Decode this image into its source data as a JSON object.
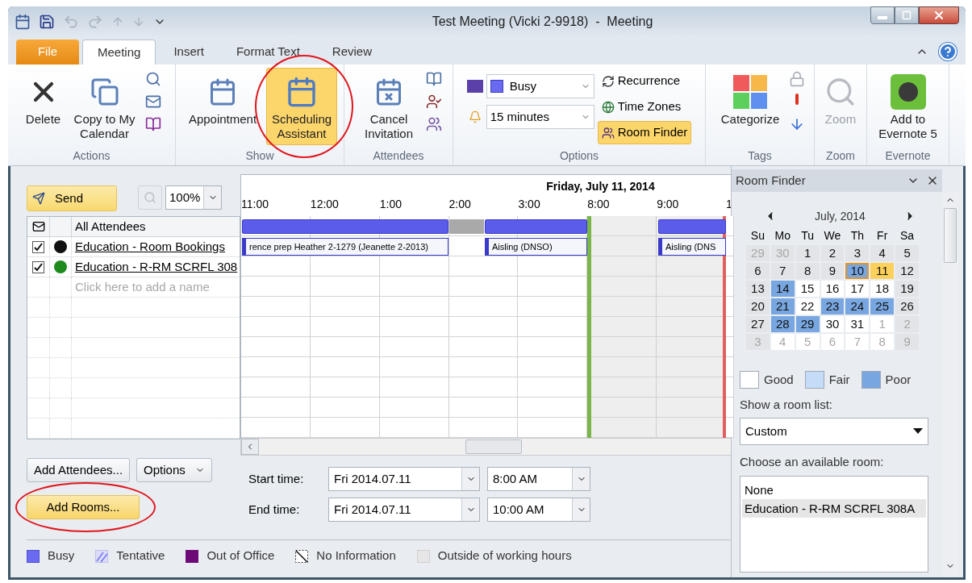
{
  "window": {
    "title": "Test Meeting (Vicki 2-9918)  -  Meeting"
  },
  "tabs": [
    {
      "label": "File",
      "kind": "file",
      "selected": false
    },
    {
      "label": "Meeting",
      "kind": "tab",
      "selected": true
    },
    {
      "label": "Insert",
      "kind": "tab",
      "selected": false
    },
    {
      "label": "Format Text",
      "kind": "tab",
      "selected": false
    },
    {
      "label": "Review",
      "kind": "tab",
      "selected": false
    }
  ],
  "ribbon": [
    {
      "kind": "actions",
      "label": "Actions",
      "buttons": [
        {
          "label": "Delete"
        },
        {
          "label": "Copy to My Calendar"
        }
      ]
    },
    {
      "kind": "show",
      "label": "Show",
      "buttons": [
        {
          "label": "Appointment",
          "selected": false,
          "circled": false
        },
        {
          "label": "Scheduling Assistant",
          "selected": true,
          "circled": true
        }
      ]
    },
    {
      "kind": "attendees",
      "label": "Attendees",
      "buttons": [
        {
          "label": "Cancel Invitation"
        }
      ]
    },
    {
      "kind": "options",
      "label": "Options",
      "show_as": "Busy",
      "reminder": "15 minutes",
      "buttons": [
        {
          "label": "Recurrence",
          "selected": false
        },
        {
          "label": "Time Zones",
          "selected": false
        },
        {
          "label": "Room Finder",
          "selected": true
        }
      ]
    },
    {
      "kind": "tags",
      "label": "Tags",
      "buttons": [
        {
          "label": "Categorize"
        }
      ]
    },
    {
      "kind": "zoom",
      "label": "Zoom",
      "buttons": [
        {
          "label": "Zoom",
          "disabled": true
        }
      ]
    },
    {
      "kind": "evernote",
      "label": "Evernote",
      "buttons": [
        {
          "label": "Add to Evernote 5"
        }
      ]
    }
  ],
  "toolbar": {
    "send": "Send",
    "zoom": "100%"
  },
  "attendees": {
    "header": "All Attendees",
    "placeholder": "Click here to add a name",
    "rows": [
      {
        "name": "Education - Room Bookings",
        "kind": "person",
        "checked": true
      },
      {
        "name": "Education - R-RM SCRFL 308",
        "kind": "room",
        "checked": true
      }
    ]
  },
  "schedule": {
    "date": "Friday, July 11, 2014",
    "hours": [
      {
        "label": "11:00",
        "selected": false
      },
      {
        "label": "12:00",
        "selected": false
      },
      {
        "label": "1:00",
        "selected": false
      },
      {
        "label": "2:00",
        "selected": false
      },
      {
        "label": "3:00",
        "selected": false
      },
      {
        "label": "8:00",
        "selected": true
      },
      {
        "label": "9:00",
        "selected": true
      },
      {
        "label": "1",
        "selected": false
      }
    ],
    "all_attendees_slots": [
      {
        "kind": "busy"
      },
      {
        "kind": "busy"
      },
      {
        "kind": "busy"
      },
      {
        "kind": "busy"
      },
      {
        "kind": "busy"
      },
      {
        "kind": "busy"
      },
      {
        "kind": "outside"
      },
      {
        "kind": "busy"
      },
      {
        "kind": "busy"
      },
      {
        "kind": "busy"
      },
      {
        "kind": "free"
      },
      {
        "kind": "free"
      },
      {
        "kind": "busy"
      },
      {
        "kind": "busy"
      }
    ],
    "rows": [
      {
        "slots": [
          {
            "kind": "event",
            "text": "rence prep Heather 2-1279 (Jeanette 2-2013)"
          },
          {
            "kind": "event"
          },
          {
            "kind": "event"
          },
          {
            "kind": "event"
          },
          {
            "kind": "event"
          },
          {
            "kind": "event"
          },
          {
            "kind": "free"
          },
          {
            "kind": "event",
            "text": "Aisling (DNSO)"
          },
          {
            "kind": "event"
          },
          {
            "kind": "event"
          },
          {
            "kind": "free"
          },
          {
            "kind": "free"
          },
          {
            "kind": "event",
            "text": "Aisling (DNS"
          },
          {
            "kind": "event"
          }
        ]
      },
      {
        "slots": [
          {
            "kind": "free"
          },
          {
            "kind": "free"
          },
          {
            "kind": "free"
          },
          {
            "kind": "free"
          },
          {
            "kind": "free"
          },
          {
            "kind": "free"
          },
          {
            "kind": "free"
          },
          {
            "kind": "free"
          },
          {
            "kind": "free"
          },
          {
            "kind": "free"
          },
          {
            "kind": "free"
          },
          {
            "kind": "free"
          },
          {
            "kind": "free"
          },
          {
            "kind": "free"
          }
        ]
      }
    ]
  },
  "buttons": [
    {
      "label": "Add Attendees...",
      "kind": "plain",
      "circled": false
    },
    {
      "label": "Options",
      "kind": "dropdown",
      "circled": false
    },
    {
      "label": "Add Rooms...",
      "kind": "highlight",
      "circled": true
    }
  ],
  "times": [
    {
      "label": "Start time:",
      "date": "Fri 2014.07.11",
      "time": "8:00 AM"
    },
    {
      "label": "End time:",
      "date": "Fri 2014.07.11",
      "time": "10:00 AM"
    }
  ],
  "legend": [
    {
      "label": "Busy",
      "kind": "busy"
    },
    {
      "label": "Tentative",
      "kind": "tentative"
    },
    {
      "label": "Out of Office",
      "kind": "oof"
    },
    {
      "label": "No Information",
      "kind": "noinfo"
    },
    {
      "label": "Outside of working hours",
      "kind": "outside"
    }
  ],
  "room_finder": {
    "title": "Room Finder",
    "month": "July, 2014",
    "weekdays": [
      "Su",
      "Mo",
      "Tu",
      "We",
      "Th",
      "Fr",
      "Sa"
    ],
    "days": [
      {
        "label": "29",
        "kind": "none",
        "muted": true,
        "today": false,
        "selected": false
      },
      {
        "label": "30",
        "kind": "none",
        "muted": true,
        "today": false,
        "selected": false
      },
      {
        "label": "1",
        "kind": "none",
        "muted": false,
        "today": false,
        "selected": false
      },
      {
        "label": "2",
        "kind": "none",
        "muted": false,
        "today": false,
        "selected": false
      },
      {
        "label": "3",
        "kind": "none",
        "muted": false,
        "today": false,
        "selected": false
      },
      {
        "label": "4",
        "kind": "none",
        "muted": false,
        "today": false,
        "selected": false
      },
      {
        "label": "5",
        "kind": "none",
        "muted": false,
        "today": false,
        "selected": false
      },
      {
        "label": "6",
        "kind": "none",
        "muted": false,
        "today": false,
        "selected": false
      },
      {
        "label": "7",
        "kind": "none",
        "muted": false,
        "today": false,
        "selected": false
      },
      {
        "label": "8",
        "kind": "none",
        "muted": false,
        "today": false,
        "selected": false
      },
      {
        "label": "9",
        "kind": "none",
        "muted": false,
        "today": false,
        "selected": false
      },
      {
        "label": "10",
        "kind": "poor",
        "muted": false,
        "today": true,
        "selected": false
      },
      {
        "label": "11",
        "kind": "none",
        "muted": false,
        "today": false,
        "selected": true
      },
      {
        "label": "12",
        "kind": "none",
        "muted": false,
        "today": false,
        "selected": false
      },
      {
        "label": "13",
        "kind": "none",
        "muted": false,
        "today": false,
        "selected": false
      },
      {
        "label": "14",
        "kind": "poor",
        "muted": false,
        "today": false,
        "selected": false
      },
      {
        "label": "15",
        "kind": "good",
        "muted": false,
        "today": false,
        "selected": false
      },
      {
        "label": "16",
        "kind": "good",
        "muted": false,
        "today": false,
        "selected": false
      },
      {
        "label": "17",
        "kind": "good",
        "muted": false,
        "today": false,
        "selected": false
      },
      {
        "label": "18",
        "kind": "good",
        "muted": false,
        "today": false,
        "selected": false
      },
      {
        "label": "19",
        "kind": "none",
        "muted": false,
        "today": false,
        "selected": false
      },
      {
        "label": "20",
        "kind": "none",
        "muted": false,
        "today": false,
        "selected": false
      },
      {
        "label": "21",
        "kind": "poor",
        "muted": false,
        "today": false,
        "selected": false
      },
      {
        "label": "22",
        "kind": "good",
        "muted": false,
        "today": false,
        "selected": false
      },
      {
        "label": "23",
        "kind": "poor",
        "muted": false,
        "today": false,
        "selected": false
      },
      {
        "label": "24",
        "kind": "poor",
        "muted": false,
        "today": false,
        "selected": false
      },
      {
        "label": "25",
        "kind": "poor",
        "muted": false,
        "today": false,
        "selected": false
      },
      {
        "label": "26",
        "kind": "none",
        "muted": false,
        "today": false,
        "selected": false
      },
      {
        "label": "27",
        "kind": "none",
        "muted": false,
        "today": false,
        "selected": false
      },
      {
        "label": "28",
        "kind": "poor",
        "muted": false,
        "today": false,
        "selected": false
      },
      {
        "label": "29",
        "kind": "poor",
        "muted": false,
        "today": false,
        "selected": false
      },
      {
        "label": "30",
        "kind": "good",
        "muted": false,
        "today": false,
        "selected": false
      },
      {
        "label": "31",
        "kind": "good",
        "muted": false,
        "today": false,
        "selected": false
      },
      {
        "label": "1",
        "kind": "good",
        "muted": true,
        "today": false,
        "selected": false
      },
      {
        "label": "2",
        "kind": "none",
        "muted": true,
        "today": false,
        "selected": false
      },
      {
        "label": "3",
        "kind": "none",
        "muted": true,
        "today": false,
        "selected": false
      },
      {
        "label": "4",
        "kind": "good",
        "muted": true,
        "today": false,
        "selected": false
      },
      {
        "label": "5",
        "kind": "good",
        "muted": true,
        "today": false,
        "selected": false
      },
      {
        "label": "6",
        "kind": "good",
        "muted": true,
        "today": false,
        "selected": false
      },
      {
        "label": "7",
        "kind": "good",
        "muted": true,
        "today": false,
        "selected": false
      },
      {
        "label": "8",
        "kind": "good",
        "muted": true,
        "today": false,
        "selected": false
      },
      {
        "label": "9",
        "kind": "none",
        "muted": true,
        "today": false,
        "selected": false
      }
    ],
    "key": [
      {
        "label": "Good",
        "kind": "good"
      },
      {
        "label": "Fair",
        "kind": "fair"
      },
      {
        "label": "Poor",
        "kind": "poor"
      }
    ],
    "list_label": "Show a room list:",
    "list_value": "Custom",
    "rooms_label": "Choose an available room:",
    "rooms": [
      {
        "name": "None",
        "selected": false
      },
      {
        "name": "Education - R-RM SCRFL 308A",
        "selected": true
      }
    ]
  }
}
